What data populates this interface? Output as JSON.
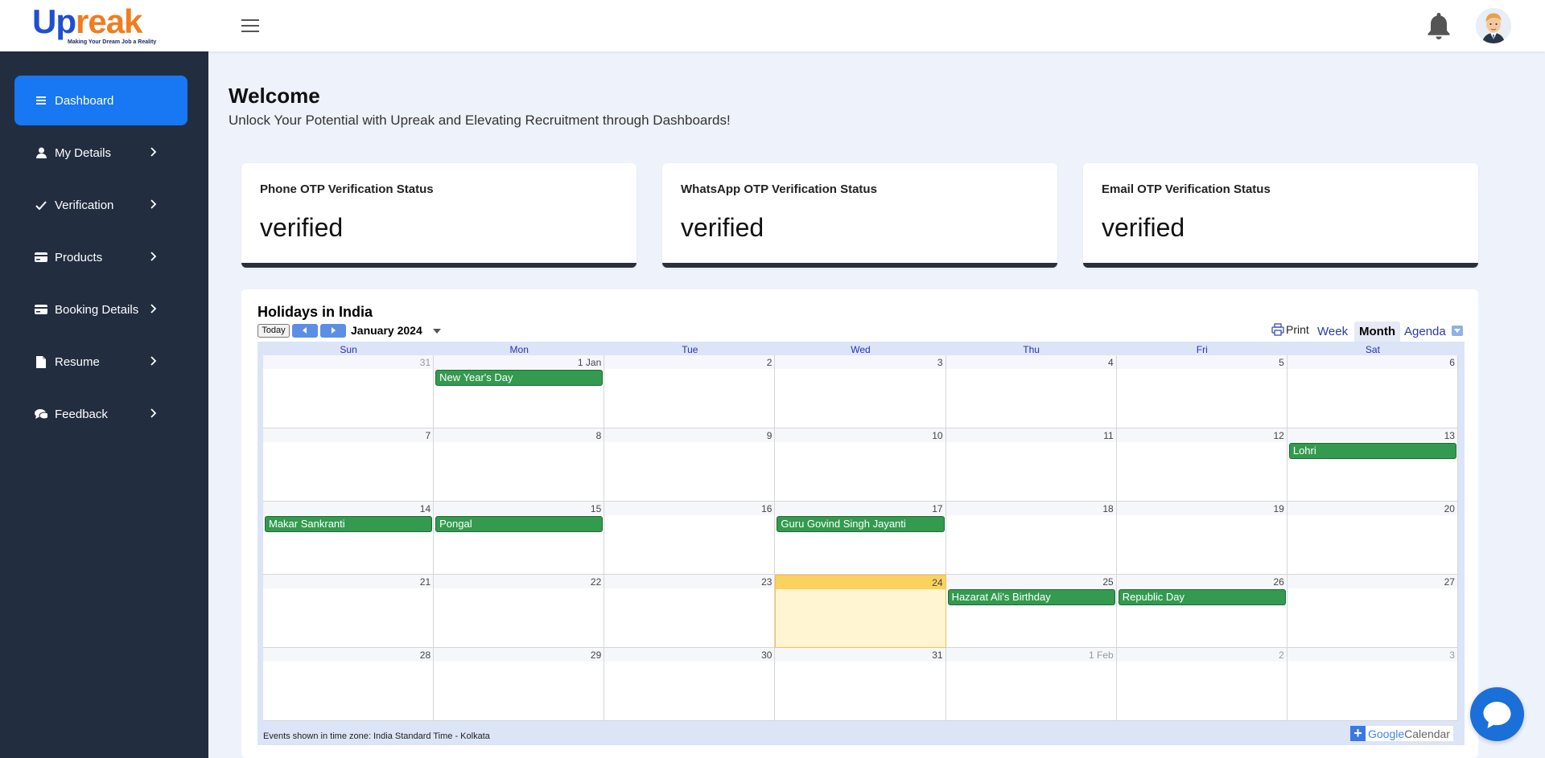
{
  "brand": {
    "logo_u": "Up",
    "logo_rest": "reak",
    "tagline": "Making Your Dream Job a Reality"
  },
  "sidebar": {
    "items": [
      {
        "label": "Dashboard",
        "icon": "list-icon",
        "active": true
      },
      {
        "label": "My Details",
        "icon": "user-icon"
      },
      {
        "label": "Verification",
        "icon": "check-icon"
      },
      {
        "label": "Products",
        "icon": "card-icon"
      },
      {
        "label": "Booking Details",
        "icon": "card-icon"
      },
      {
        "label": "Resume",
        "icon": "document-icon"
      },
      {
        "label": "Feedback",
        "icon": "chat-bubbles-icon"
      }
    ]
  },
  "main": {
    "title": "Welcome",
    "subtitle": "Unlock Your Potential with Upreak and Elevating Recruitment through Dashboards!"
  },
  "cards": [
    {
      "title": "Phone OTP Verification Status",
      "value": "verified"
    },
    {
      "title": "WhatsApp OTP Verification Status",
      "value": "verified"
    },
    {
      "title": "Email OTP Verification Status",
      "value": "verified"
    }
  ],
  "calendar": {
    "title": "Holidays in India",
    "today_label": "Today",
    "month_label": "January 2024",
    "print_label": "Print",
    "views": [
      "Week",
      "Month",
      "Agenda"
    ],
    "active_view": "Month",
    "weekdays": [
      "Sun",
      "Mon",
      "Tue",
      "Wed",
      "Thu",
      "Fri",
      "Sat"
    ],
    "weeks": [
      [
        "31",
        "1 Jan",
        "2",
        "3",
        "4",
        "5",
        "6"
      ],
      [
        "7",
        "8",
        "9",
        "10",
        "11",
        "12",
        "13"
      ],
      [
        "14",
        "15",
        "16",
        "17",
        "18",
        "19",
        "20"
      ],
      [
        "21",
        "22",
        "23",
        "24",
        "25",
        "26",
        "27"
      ],
      [
        "28",
        "29",
        "30",
        "31",
        "1 Feb",
        "2",
        "3"
      ]
    ],
    "other_month_cells": [
      [
        0,
        0
      ],
      [
        4,
        4
      ],
      [
        4,
        5
      ],
      [
        4,
        6
      ]
    ],
    "today_cell": [
      3,
      3
    ],
    "events": [
      {
        "title": "New Year's Day",
        "week": 0,
        "day": 1
      },
      {
        "title": "Lohri",
        "week": 1,
        "day": 6
      },
      {
        "title": "Makar Sankranti",
        "week": 2,
        "day": 0
      },
      {
        "title": "Pongal",
        "week": 2,
        "day": 1
      },
      {
        "title": "Guru Govind Singh Jayanti",
        "week": 2,
        "day": 3
      },
      {
        "title": "Hazarat Ali's Birthday",
        "week": 3,
        "day": 4
      },
      {
        "title": "Republic Day",
        "week": 3,
        "day": 5
      }
    ],
    "timezone_text": "Events shown in time zone: India Standard Time - Kolkata",
    "gcal_google": "Google",
    "gcal_calendar": "Calendar"
  },
  "colors": {
    "accent": "#1877f2",
    "sidebar_bg": "#222d3f",
    "event": "#339a4f",
    "today": "#fbd25e"
  }
}
